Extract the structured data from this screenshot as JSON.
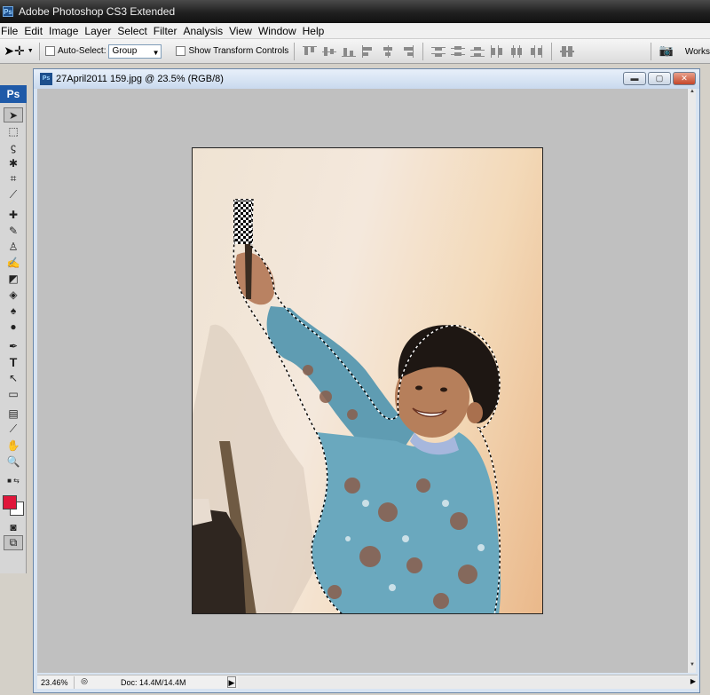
{
  "app": {
    "title": "Adobe Photoshop CS3 Extended",
    "logo": "Ps"
  },
  "menu": [
    "File",
    "Edit",
    "Image",
    "Layer",
    "Select",
    "Filter",
    "Analysis",
    "View",
    "Window",
    "Help"
  ],
  "options": {
    "auto_select_label": "Auto-Select:",
    "auto_select_value": "Group",
    "transform_label": "Show Transform Controls",
    "workspace_label": "Works"
  },
  "document": {
    "title": "27April2011 159.jpg @ 23.5% (RGB/8)",
    "icon_label": "Ps"
  },
  "statusbar": {
    "zoom": "23.46%",
    "doc_size": "Doc: 14.4M/14.4M"
  },
  "colors": {
    "foreground": "#e0163a",
    "background": "#ffffff"
  },
  "tools": [
    "move-tool",
    "marquee-tool",
    "lasso-tool",
    "magic-wand-tool",
    "crop-tool",
    "slice-tool",
    "healing-brush-tool",
    "brush-tool",
    "clone-stamp-tool",
    "history-brush-tool",
    "eraser-tool",
    "paint-bucket-tool",
    "blur-tool",
    "dodge-tool",
    "pen-tool",
    "type-tool",
    "path-selection-tool",
    "rectangle-tool",
    "notes-tool",
    "eyedropper-tool",
    "hand-tool",
    "zoom-tool"
  ]
}
